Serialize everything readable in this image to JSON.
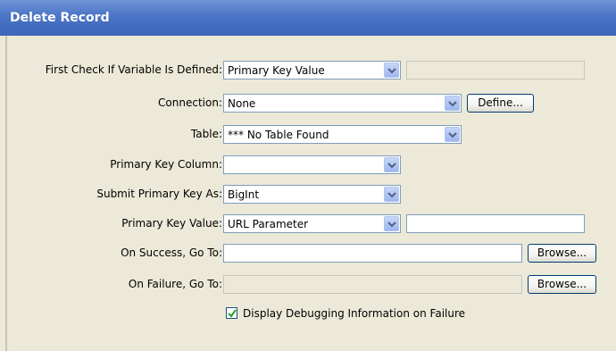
{
  "window": {
    "title": "Delete Record"
  },
  "form": {
    "check_variable": {
      "label": "First Check If Variable Is Defined:",
      "value": "Primary Key Value",
      "text_value": ""
    },
    "connection": {
      "label": "Connection:",
      "value": "None",
      "define_label": "Define..."
    },
    "table": {
      "label": "Table:",
      "value": "*** No Table Found"
    },
    "primary_key_column": {
      "label": "Primary Key Column:",
      "value": ""
    },
    "submit_primary_key_as": {
      "label": "Submit Primary Key As:",
      "value": "BigInt"
    },
    "primary_key_value": {
      "label": "Primary Key Value:",
      "value": "URL Parameter",
      "text_value": ""
    },
    "on_success": {
      "label": "On Success, Go To:",
      "value": "",
      "browse_label": "Browse..."
    },
    "on_failure": {
      "label": "On Failure, Go To:",
      "value": "",
      "browse_label": "Browse..."
    },
    "debug": {
      "label": "Display Debugging Information on Failure",
      "checked": true
    }
  }
}
